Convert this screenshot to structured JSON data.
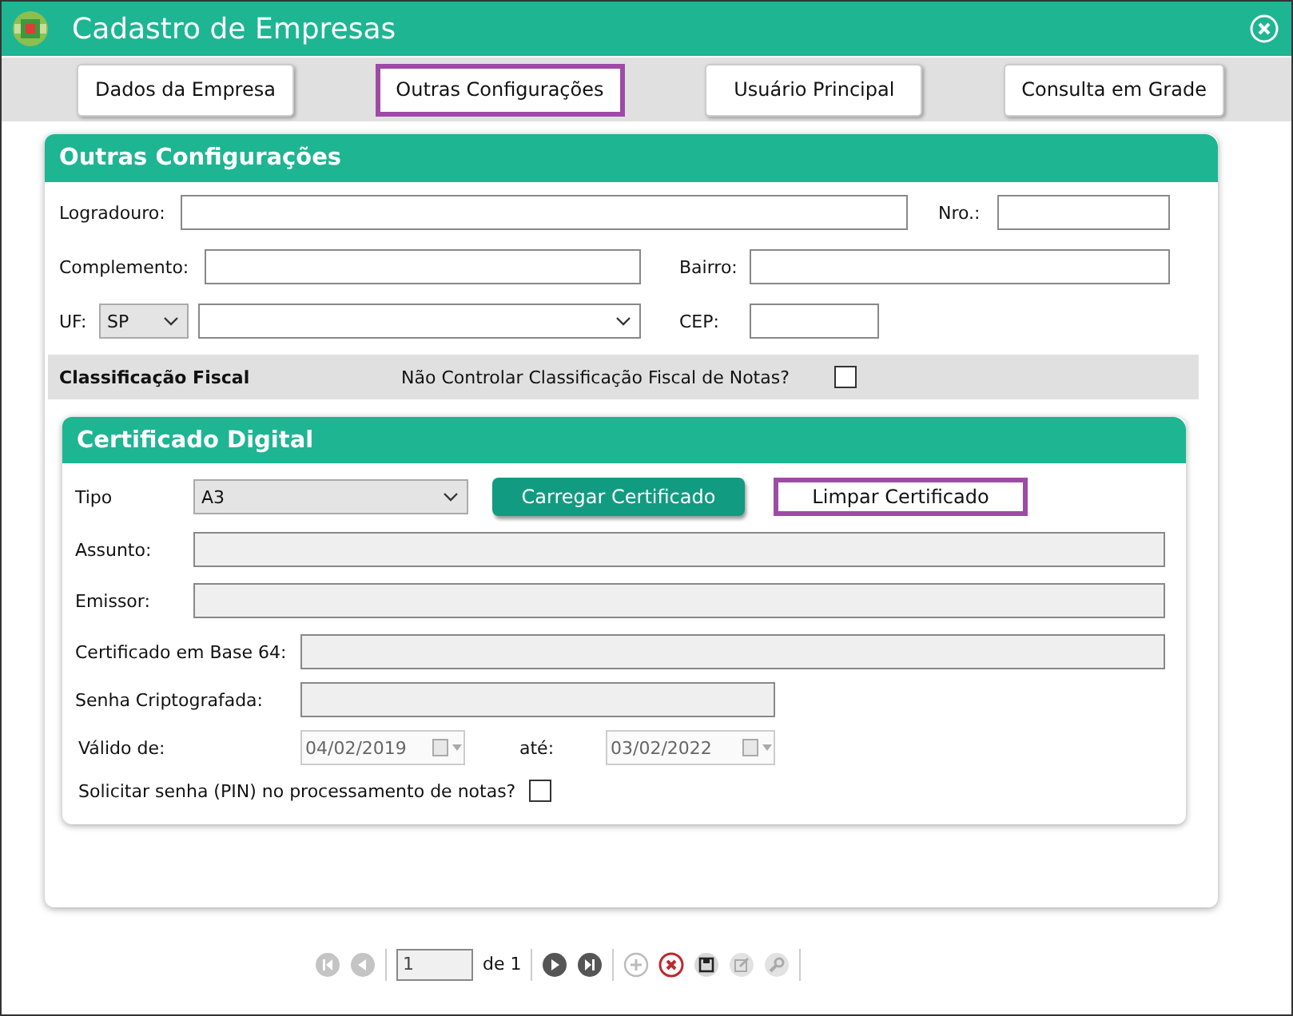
{
  "window": {
    "title": "Cadastro de Empresas"
  },
  "tabs": [
    {
      "label": "Dados da Empresa",
      "selected": false
    },
    {
      "label": "Outras Configurações",
      "selected": true
    },
    {
      "label": "Usuário Principal",
      "selected": false
    },
    {
      "label": "Consulta em Grade",
      "selected": false
    }
  ],
  "section": {
    "title": "Outras Configurações",
    "logradouro": {
      "label": "Logradouro:"
    },
    "nro": {
      "label": "Nro.:"
    },
    "complemento": {
      "label": "Complemento:"
    },
    "bairro": {
      "label": "Bairro:"
    },
    "uf": {
      "label": "UF:",
      "value": "SP"
    },
    "cep": {
      "label": "CEP:"
    },
    "fiscal": {
      "title": "Classificação Fiscal",
      "question": "Não Controlar Classificação Fiscal de Notas?",
      "checked": false
    }
  },
  "certificate": {
    "title": "Certificado Digital",
    "tipo": {
      "label": "Tipo",
      "value": "A3"
    },
    "buttons": [
      {
        "label": "Carregar Certificado",
        "kind": "primary",
        "focused": false
      },
      {
        "label": "Limpar Certificado",
        "kind": "plain",
        "focused": true
      }
    ],
    "assunto": {
      "label": "Assunto:"
    },
    "emissor": {
      "label": "Emissor:"
    },
    "base64": {
      "label": "Certificado em Base 64:"
    },
    "senha": {
      "label": "Senha Criptografada:"
    },
    "valid_from": {
      "label": "Válido de:",
      "value": "04/02/2019",
      "disabled": true
    },
    "valid_to": {
      "label": "até:",
      "value": "03/02/2022",
      "disabled": true
    },
    "pin": {
      "label": "Solicitar senha (PIN) no processamento de notas?",
      "checked": false
    }
  },
  "pager": {
    "page": "1",
    "of": "de 1",
    "tools": [
      {
        "kind": "first",
        "disabled": true
      },
      {
        "kind": "prev",
        "disabled": true
      },
      {
        "kind": "next",
        "disabled": false
      },
      {
        "kind": "last",
        "disabled": false
      },
      {
        "kind": "add",
        "disabled": true
      },
      {
        "kind": "delete",
        "disabled": false
      },
      {
        "kind": "save",
        "disabled": false
      },
      {
        "kind": "edit",
        "disabled": true
      },
      {
        "kind": "search",
        "disabled": true
      }
    ]
  }
}
